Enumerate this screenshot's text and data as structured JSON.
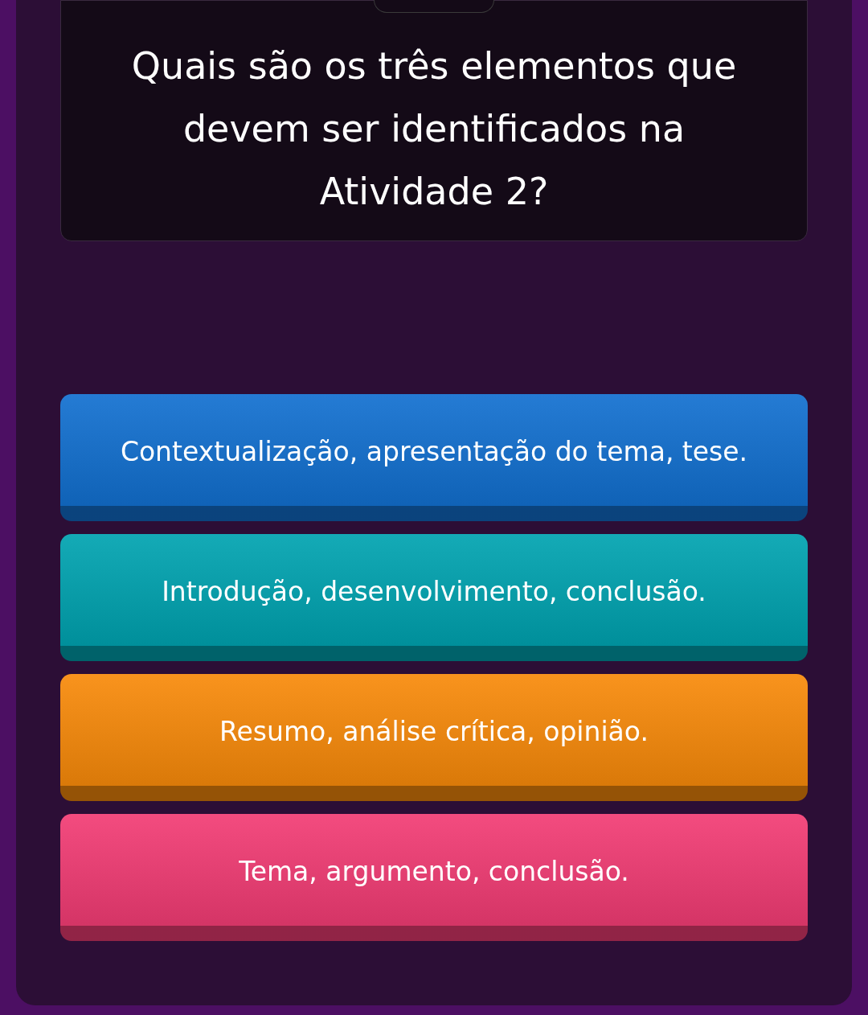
{
  "question": "Quais são os três elementos que devem ser identificados na Atividade 2?",
  "answers": [
    {
      "text": "Contextualização, apresentação do tema, tese.",
      "color": "#1270d0"
    },
    {
      "text": "Introdução, desenvolvimento, conclusão.",
      "color": "#00a3b0"
    },
    {
      "text": "Resumo, análise crítica, opinião.",
      "color": "#f88a0a"
    },
    {
      "text": "Tema, argumento, conclusão.",
      "color": "#f23c74"
    }
  ]
}
